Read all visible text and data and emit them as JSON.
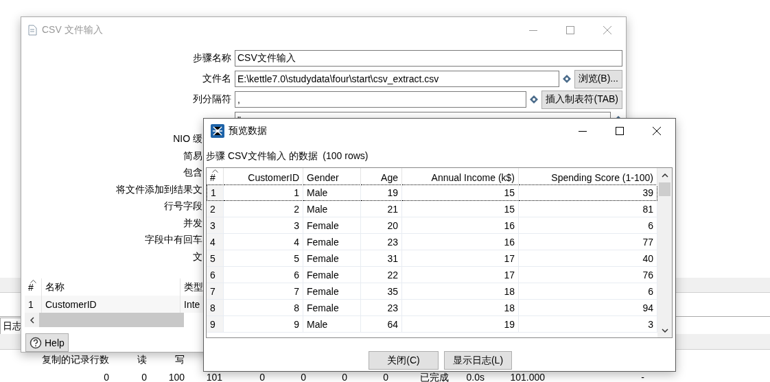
{
  "background": {
    "log_tab": "日志",
    "stats_columns": [
      "复制的记录行数",
      "读",
      "写"
    ],
    "stats_row": [
      "0",
      "0",
      "100",
      "101",
      "0",
      "0",
      "0",
      "0",
      "已完成",
      "0.0s",
      "101.000",
      "-"
    ]
  },
  "csv_dialog": {
    "title": "CSV 文件输入",
    "active": false,
    "fields": [
      {
        "label": "步骤名称",
        "value": "CSV文件输入"
      },
      {
        "label": "文件名",
        "value": "E:\\kettle7.0\\studydata\\four\\start\\csv_extract.csv",
        "variable": true,
        "button": "浏览(B)..."
      },
      {
        "label": "列分隔符",
        "value": ",",
        "variable": true,
        "button": "插入制表符(TAB)"
      },
      {
        "value": "\"",
        "variable": true
      }
    ],
    "partial_labels": [
      "NIO 缓",
      "简易",
      "包含",
      "将文件添加到结果文",
      "行号字段",
      "并发",
      "字段中有回车",
      "文"
    ],
    "table": {
      "columns": [
        "#",
        "名称",
        "类型"
      ],
      "rows": [
        [
          "1",
          "CustomerID",
          "Inte"
        ]
      ]
    },
    "help_button": "Help"
  },
  "preview": {
    "title": "预览数据",
    "active": true,
    "caption": "步骤 CSV文件输入 的数据  (100 rows)",
    "columns": [
      {
        "label": "#",
        "kind": "index"
      },
      {
        "label": "CustomerID",
        "kind": "number"
      },
      {
        "label": "Gender",
        "kind": "text"
      },
      {
        "label": "Age",
        "kind": "number"
      },
      {
        "label": "Annual Income (k$)",
        "kind": "number"
      },
      {
        "label": "Spending Score (1-100)",
        "kind": "number"
      }
    ],
    "rows": [
      {
        "cells": [
          "1",
          "1",
          "Male",
          "19",
          "15",
          "39"
        ],
        "selected": true
      },
      {
        "cells": [
          "2",
          "2",
          "Male",
          "21",
          "15",
          "81"
        ],
        "selected": false
      },
      {
        "cells": [
          "3",
          "3",
          "Female",
          "20",
          "16",
          "6"
        ],
        "selected": false
      },
      {
        "cells": [
          "4",
          "4",
          "Female",
          "23",
          "16",
          "77"
        ],
        "selected": false
      },
      {
        "cells": [
          "5",
          "5",
          "Female",
          "31",
          "17",
          "40"
        ],
        "selected": false
      },
      {
        "cells": [
          "6",
          "6",
          "Female",
          "22",
          "17",
          "76"
        ],
        "selected": false
      },
      {
        "cells": [
          "7",
          "7",
          "Female",
          "35",
          "18",
          "6"
        ],
        "selected": false
      },
      {
        "cells": [
          "8",
          "8",
          "Female",
          "23",
          "18",
          "94"
        ],
        "selected": false
      },
      {
        "cells": [
          "9",
          "9",
          "Male",
          "64",
          "19",
          "3"
        ],
        "selected": false
      }
    ],
    "buttons": [
      "关闭(C)",
      "显示日志(L)"
    ]
  }
}
